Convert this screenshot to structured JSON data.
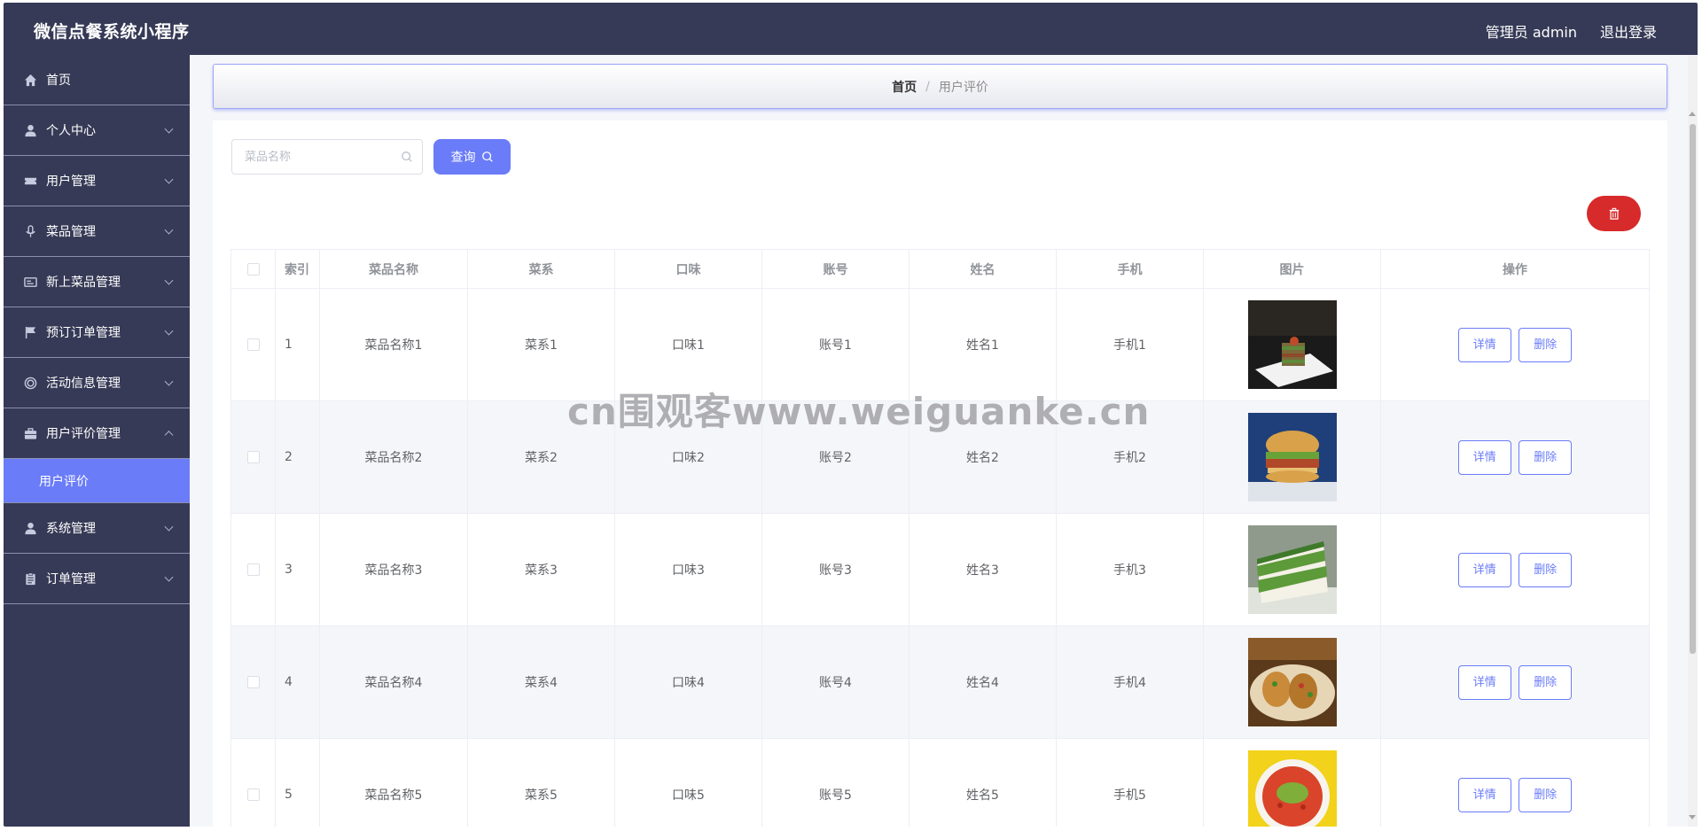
{
  "header": {
    "title": "微信点餐系统小程序",
    "admin_label": "管理员 admin",
    "logout_label": "退出登录"
  },
  "sidebar": {
    "items": [
      {
        "label": "首页",
        "icon": "home-icon",
        "has_arrow": false
      },
      {
        "label": "个人中心",
        "icon": "user-icon",
        "has_arrow": true
      },
      {
        "label": "用户管理",
        "icon": "ticket-icon",
        "has_arrow": true
      },
      {
        "label": "菜品管理",
        "icon": "microphone-icon",
        "has_arrow": true
      },
      {
        "label": "新上菜品管理",
        "icon": "card-icon",
        "has_arrow": true
      },
      {
        "label": "预订订单管理",
        "icon": "flag-icon",
        "has_arrow": true
      },
      {
        "label": "活动信息管理",
        "icon": "target-icon",
        "has_arrow": true
      },
      {
        "label": "用户评价管理",
        "icon": "briefcase-icon",
        "has_arrow": true,
        "expanded": true
      },
      {
        "label": "系统管理",
        "icon": "user-icon",
        "has_arrow": true
      },
      {
        "label": "订单管理",
        "icon": "clipboard-icon",
        "has_arrow": true
      }
    ],
    "active_subitem": "用户评价"
  },
  "breadcrumb": {
    "home": "首页",
    "separator": "/",
    "current": "用户评价"
  },
  "search": {
    "placeholder": "菜品名称",
    "query_label": "查询"
  },
  "table": {
    "columns": [
      "索引",
      "菜品名称",
      "菜系",
      "口味",
      "账号",
      "姓名",
      "手机",
      "图片",
      "操作"
    ],
    "rows": [
      {
        "index": "1",
        "dish": "菜品名称1",
        "cuisine": "菜系1",
        "taste": "口味1",
        "account": "账号1",
        "name": "姓名1",
        "phone": "手机1",
        "image": "layered-sandwich-dish"
      },
      {
        "index": "2",
        "dish": "菜品名称2",
        "cuisine": "菜系2",
        "taste": "口味2",
        "account": "账号2",
        "name": "姓名2",
        "phone": "手机2",
        "image": "burger"
      },
      {
        "index": "3",
        "dish": "菜品名称3",
        "cuisine": "菜系3",
        "taste": "口味3",
        "account": "账号3",
        "name": "姓名3",
        "phone": "手机3",
        "image": "green-layer-cake"
      },
      {
        "index": "4",
        "dish": "菜品名称4",
        "cuisine": "菜系4",
        "taste": "口味4",
        "account": "账号4",
        "name": "姓名4",
        "phone": "手机4",
        "image": "tacos"
      },
      {
        "index": "5",
        "dish": "菜品名称5",
        "cuisine": "菜系5",
        "taste": "口味5",
        "account": "账号5",
        "name": "姓名5",
        "phone": "手机5",
        "image": "chili-fish-dish"
      }
    ],
    "detail_label": "详情",
    "delete_label": "删除"
  },
  "watermark": "cn围观客www.weiguanke.cn",
  "colors": {
    "sidebar_bg": "#363a56",
    "accent": "#6a7cf8",
    "danger": "#d72a2a"
  }
}
